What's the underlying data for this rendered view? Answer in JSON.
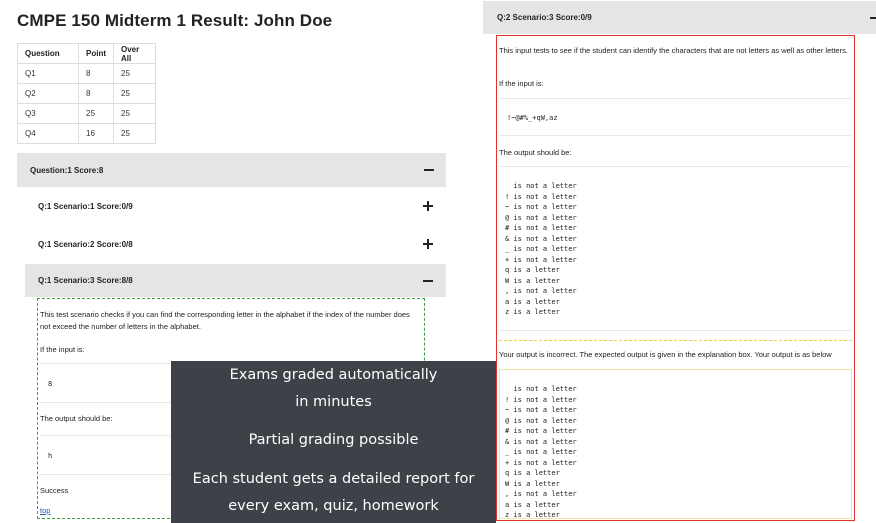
{
  "page": {
    "title": "CMPE 150 Midterm 1 Result: John Doe"
  },
  "scores_table": {
    "headers": [
      "Question",
      "Point",
      "Over All"
    ],
    "rows": [
      [
        "Q1",
        "8",
        "25"
      ],
      [
        "Q2",
        "8",
        "25"
      ],
      [
        "Q3",
        "25",
        "25"
      ],
      [
        "Q4",
        "16",
        "25"
      ]
    ]
  },
  "question1": {
    "header": "Question:1 Score:8",
    "scenarios": [
      {
        "label": "Q:1 Scenario:1 Score:0/9",
        "expanded": false
      },
      {
        "label": "Q:1 Scenario:2 Score:0/8",
        "expanded": false
      },
      {
        "label": "Q:1 Scenario:3 Score:8/8",
        "expanded": true
      }
    ],
    "detail": {
      "description": "This test scenario checks if you can find the corresponding letter in the alphabet if the index of the number does not exceed the number of letters in the alphabet.",
      "input_label": "If the input is:",
      "input_value": "8",
      "output_label": "The output should be:",
      "output_value": "h",
      "result": "Success",
      "link": "top"
    }
  },
  "right_panel": {
    "header": "Q:2 Scenario:3 Score:0/9",
    "description": "This input tests to see if the student can identify the characters that are not letters as well as other letters.",
    "input_label": "If the input is:",
    "input_value": "!~@#%_+qW,az",
    "output_label": "The output should be:",
    "expected_lines": [
      "  is not a letter",
      "! is not a letter",
      "~ is not a letter",
      "@ is not a letter",
      "# is not a letter",
      "& is not a letter",
      "_ is not a letter",
      "+ is not a letter",
      "q is a letter",
      "W is a letter",
      ", is not a letter",
      "a is a letter",
      "z is a letter"
    ],
    "incorrect_msg": "Your output is incorrect. The expected output is given in the explanation box. Your output is as below",
    "actual_lines": [
      "  is not a letter",
      "! is not a letter",
      "~ is not a letter",
      "@ is not a letter",
      "# is not a letter",
      "& is not a letter",
      "_ is not a letter",
      "+ is not a letter",
      "q is a letter",
      "W is a letter",
      ", is not a letter",
      "a is a letter",
      "z is a letter"
    ]
  },
  "promo": {
    "line1": "Exams graded automatically",
    "line2": "in minutes",
    "line3": "Partial grading possible",
    "line4": "Each student gets a detailed report for",
    "line5": "every exam, quiz, homework"
  },
  "colors": {
    "header_bg": "#e5e5e5",
    "success_border": "#3ca13c",
    "error_border": "#e03030",
    "overlay_bg": "#3d4248"
  }
}
